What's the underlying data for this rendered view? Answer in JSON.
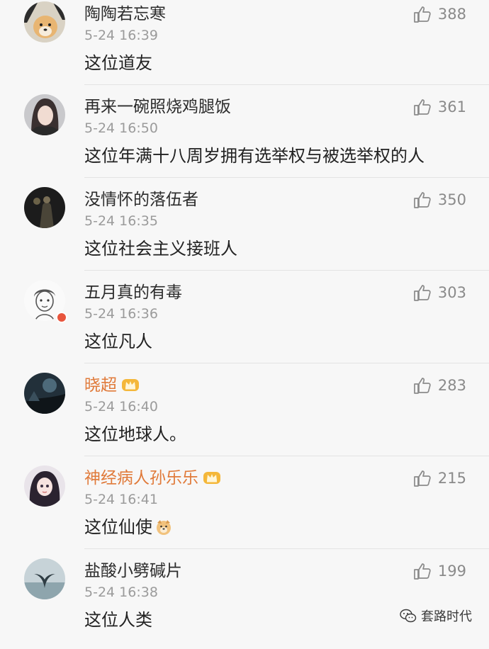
{
  "comments": [
    {
      "name": "陶陶若忘寒",
      "time": "5-24 16:39",
      "text": "这位道友",
      "likes": "388",
      "avatar": "dog-avatar"
    },
    {
      "name": "再来一碗照烧鸡腿饭",
      "time": "5-24 16:50",
      "text": "这位年满十八周岁拥有选举权与被选举权的人",
      "likes": "361",
      "avatar": "girl-avatar"
    },
    {
      "name": "没情怀的落伍者",
      "time": "5-24 16:35",
      "text": "这位社会主义接班人",
      "likes": "350",
      "avatar": "dark-avatar"
    },
    {
      "name": "五月真的有毒",
      "time": "5-24 16:36",
      "text": "这位凡人",
      "likes": "303",
      "avatar": "sketch-avatar"
    },
    {
      "name": "晓超",
      "time": "5-24 16:40",
      "text": "这位地球人。",
      "likes": "283",
      "avatar": "night-avatar"
    },
    {
      "name": "神经病人孙乐乐",
      "time": "5-24 16:41",
      "text": "这位仙使",
      "likes": "215",
      "avatar": "anime-avatar"
    },
    {
      "name": "盐酸小劈碱片",
      "time": "5-24 16:38",
      "text": "这位人类",
      "likes": "199",
      "avatar": "whale-avatar"
    }
  ],
  "watermark": "套路时代",
  "colors": {
    "background": "#f7f7f7",
    "name": "#2c2c2c",
    "vip_name": "#e07a3a",
    "time": "#9b9b9b",
    "text": "#222222",
    "likes": "#8a8a8a"
  }
}
